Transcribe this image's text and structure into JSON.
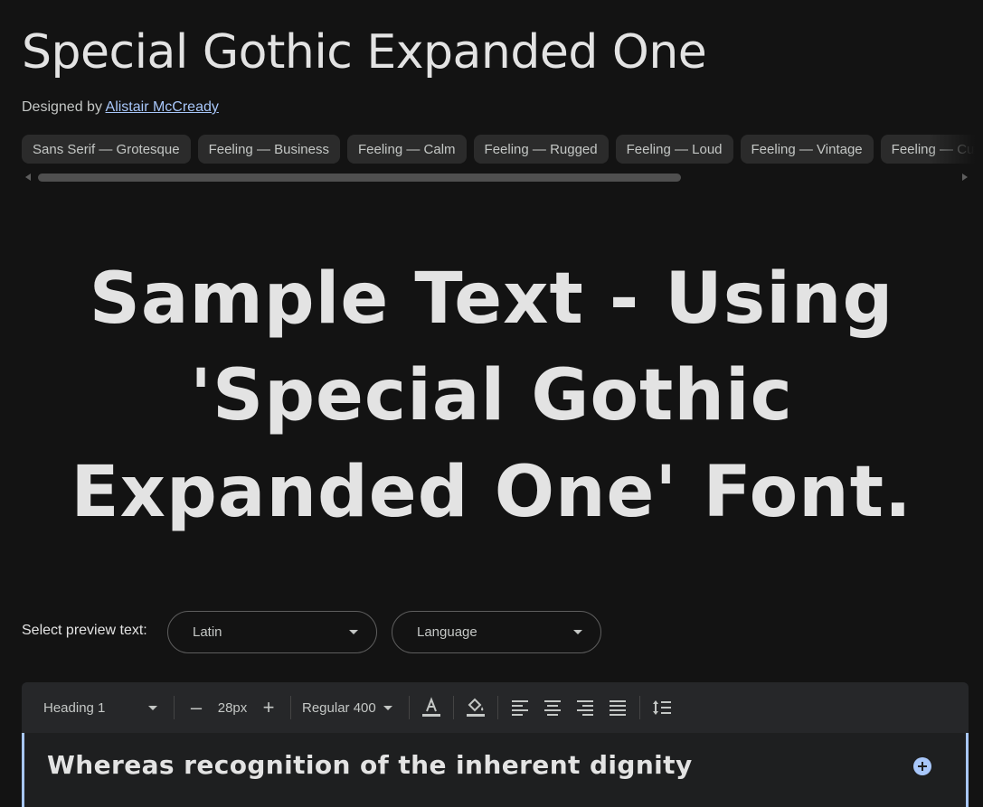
{
  "header": {
    "font_name": "Special Gothic Expanded One",
    "designed_by_prefix": "Designed by",
    "designer": "Alistair McCready"
  },
  "tags": [
    "Sans Serif — Grotesque",
    "Feeling — Business",
    "Feeling — Calm",
    "Feeling — Rugged",
    "Feeling — Loud",
    "Feeling — Vintage",
    "Feeling — Cute"
  ],
  "sample": {
    "lines": [
      "Sample Text - Using",
      "'Special Gothic",
      "Expanded One' Font."
    ]
  },
  "preview": {
    "label": "Select preview text:",
    "script_value": "Latin",
    "language_value": "Language"
  },
  "toolbar": {
    "style_value": "Heading 1",
    "decrease_label": "–",
    "size_value": "28px",
    "increase_label": "+",
    "weight_value": "Regular 400"
  },
  "editor": {
    "text": "Whereas recognition of the inherent dignity"
  },
  "colors": {
    "background": "#131313",
    "chip": "#2b2b2b",
    "accent": "#a8c7fa",
    "text": "#e3e3e3"
  }
}
